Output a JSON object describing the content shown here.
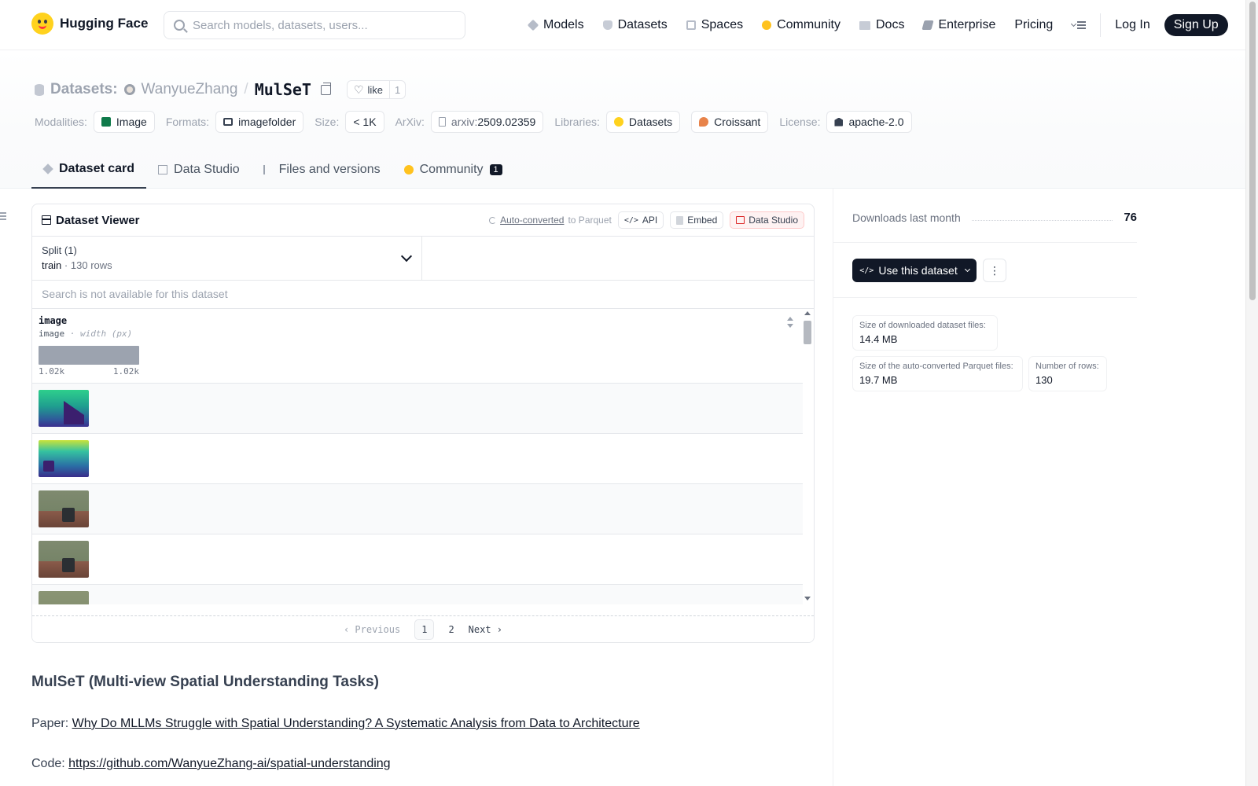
{
  "nav": {
    "brand": "Hugging Face",
    "search_placeholder": "Search models, datasets, users...",
    "links": [
      "Models",
      "Datasets",
      "Spaces",
      "Community",
      "Docs",
      "Enterprise",
      "Pricing"
    ],
    "login": "Log In",
    "signup": "Sign Up"
  },
  "repo": {
    "section": "Datasets:",
    "user": "WanyueZhang",
    "sep": "/",
    "name": "MulSeT",
    "like_label": "like",
    "like_count": "1"
  },
  "meta": {
    "modalities_label": "Modalities:",
    "modality": "Image",
    "formats_label": "Formats:",
    "format": "imagefolder",
    "size_label": "Size:",
    "size": "< 1K",
    "arxiv_label": "ArXiv:",
    "arxiv_prefix": "arxiv:",
    "arxiv_id": "2509.02359",
    "libraries_label": "Libraries:",
    "libraries": [
      "Datasets",
      "Croissant"
    ],
    "license_label": "License:",
    "license": "apache-2.0"
  },
  "tabs": {
    "card": "Dataset card",
    "studio": "Data Studio",
    "files": "Files and versions",
    "community": "Community",
    "community_badge": "1"
  },
  "viewer": {
    "title": "Dataset Viewer",
    "auto_converted": "Auto-converted",
    "to_parquet": "to Parquet",
    "api": "API",
    "embed": "Embed",
    "data_studio": "Data Studio",
    "split_label": "Split (1)",
    "split_name": "train",
    "split_dot": "·",
    "split_rows": "130 rows",
    "search_na": "Search is not available for this dataset",
    "column_name": "image",
    "column_type": "image",
    "column_sub": "· width (px)",
    "hist_min": "1.02k",
    "hist_max": "1.02k",
    "pager": {
      "prev": "Previous",
      "page1": "1",
      "page2": "2",
      "next": "Next"
    }
  },
  "card": {
    "title": "MulSeT (Multi-view Spatial Understanding Tasks)",
    "paper_label": "Paper:",
    "paper_link": "Why Do MLLMs Struggle with Spatial Understanding? A Systematic Analysis from Data to Architecture",
    "code_label": "Code:",
    "code_link": "https://github.com/WanyueZhang-ai/spatial-understanding"
  },
  "sidebar": {
    "downloads_label": "Downloads last month",
    "downloads_value": "76",
    "use_button": "Use this dataset",
    "size_download_label": "Size of downloaded dataset files:",
    "size_download_value": "14.4 MB",
    "size_parquet_label": "Size of the auto-converted Parquet files:",
    "size_parquet_value": "19.7 MB",
    "rows_label": "Number of rows:",
    "rows_value": "130"
  },
  "icons": [
    "search-icon",
    "models-icon",
    "datasets-icon",
    "spaces-icon",
    "community-icon",
    "docs-icon",
    "enterprise-icon",
    "menu-icon",
    "copy-icon",
    "heart-icon",
    "image-icon",
    "folder-icon",
    "document-icon",
    "hf-icon",
    "croissant-icon",
    "bank-icon",
    "table-icon",
    "sync-icon",
    "code-icon",
    "chevron-down-icon",
    "sort-icon",
    "kebab-icon"
  ]
}
